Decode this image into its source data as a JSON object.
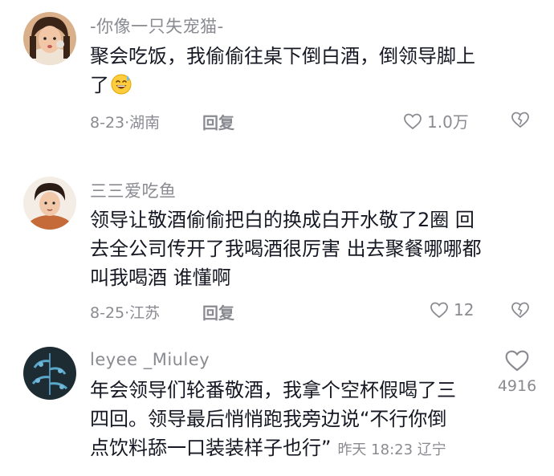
{
  "comments": [
    {
      "username": "-你像一只失宠猫-",
      "text_line1": "聚会吃饭，我偷偷往桌下倒白酒，倒领导脚上",
      "text_line2": "了",
      "emoji": "sweat-smile-emoji",
      "date": "8-23",
      "location": "湖南",
      "reply_label": "回复",
      "likes": "1.0万"
    },
    {
      "username": "三三爱吃鱼",
      "text_line1": "领导让敬酒偷偷把白的换成白开水敬了2圈 回",
      "text_line2": "去全公司传开了我喝酒很厉害 出去聚餐哪哪都",
      "text_line3": "叫我喝酒 谁懂啊",
      "date": "8-25",
      "location": "江苏",
      "reply_label": "回复",
      "likes": "12"
    },
    {
      "username": "leyee _Miuley",
      "text_line1": "年会领导们轮番敬酒，我拿个空杯假喝了三",
      "text_line2": "四回。领导最后悄悄跑我旁边说“不行你倒",
      "text_line3": "点饮料舔一口装装样子也行”",
      "date": "昨天 18:23",
      "location": "辽宁",
      "likes": "4916"
    }
  ],
  "colors": {
    "text": "#161823",
    "muted": "#8a8b91",
    "background": "#ffffff"
  },
  "icons": [
    "heart-outline-icon",
    "broken-heart-icon"
  ]
}
